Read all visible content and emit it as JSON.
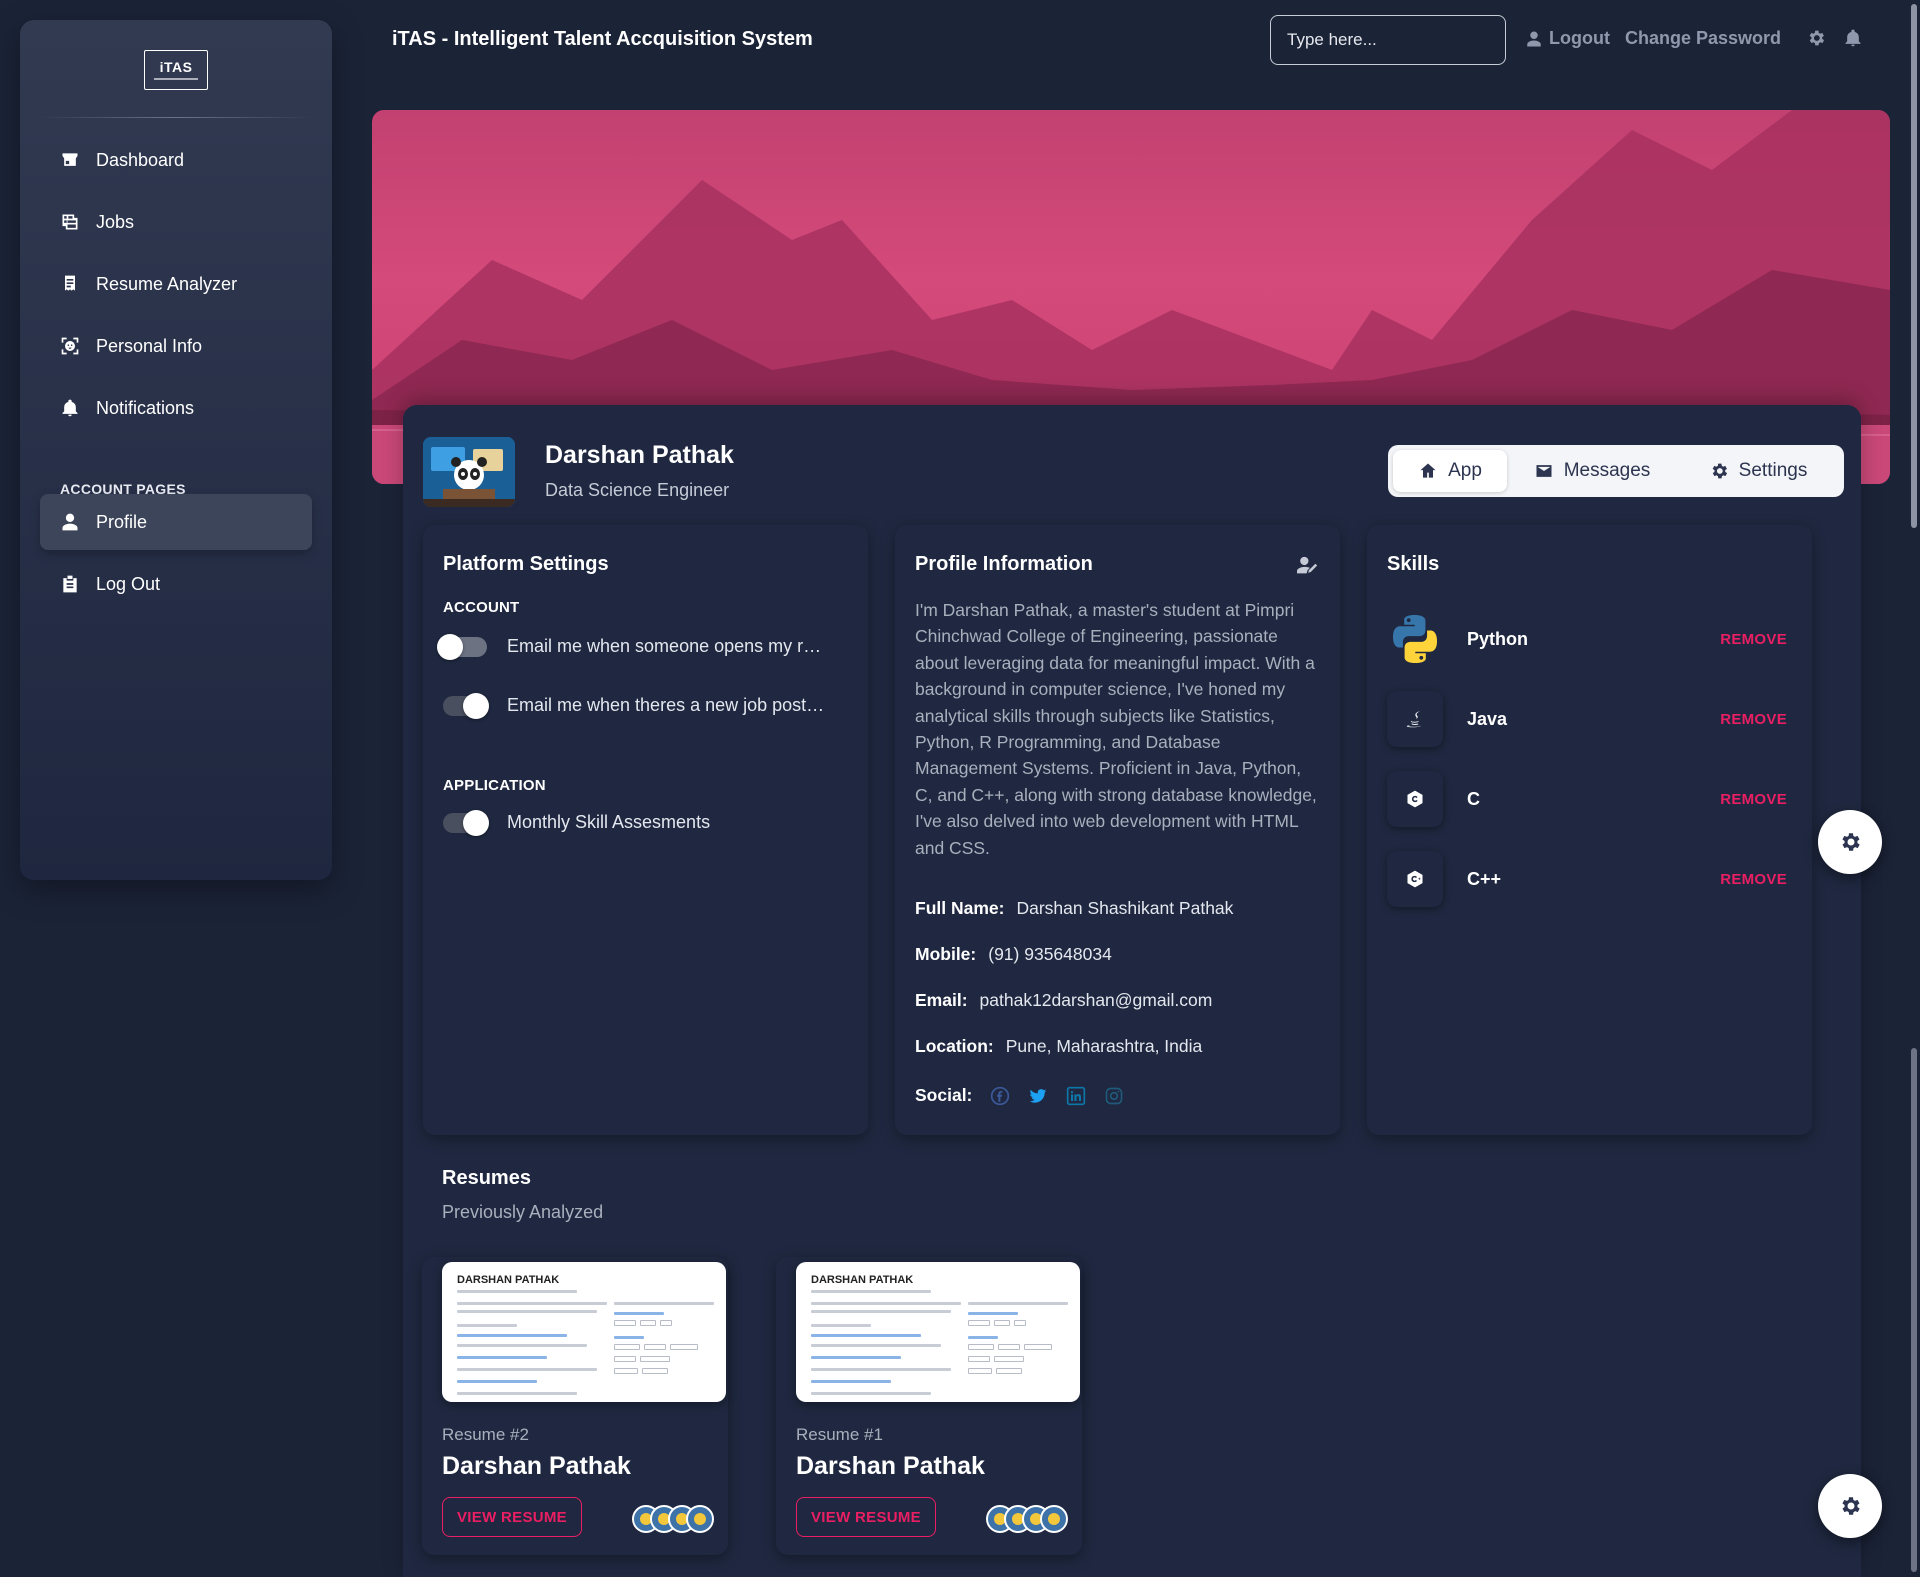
{
  "app": {
    "title": "iTAS - Intelligent Talent Accquisition System"
  },
  "logo": {
    "text": "iTAS"
  },
  "sidebar": {
    "items": [
      {
        "label": "Dashboard",
        "icon": "store-icon"
      },
      {
        "label": "Jobs",
        "icon": "table-icon"
      },
      {
        "label": "Resume Analyzer",
        "icon": "receipt-icon"
      },
      {
        "label": "Personal Info",
        "icon": "scan-face-icon"
      },
      {
        "label": "Notifications",
        "icon": "bell-icon"
      }
    ],
    "section_label": "ACCOUNT PAGES",
    "account_items": [
      {
        "label": "Profile",
        "icon": "person-icon",
        "active": true
      },
      {
        "label": "Log Out",
        "icon": "badge-icon"
      }
    ]
  },
  "topbar": {
    "search_placeholder": "Type here...",
    "logout_label": "Logout",
    "change_password_label": "Change Password"
  },
  "profile": {
    "name": "Darshan Pathak",
    "role": "Data Science Engineer",
    "tabs": [
      {
        "label": "App",
        "icon": "home-icon",
        "active": true
      },
      {
        "label": "Messages",
        "icon": "mail-icon"
      },
      {
        "label": "Settings",
        "icon": "gear-icon"
      }
    ]
  },
  "platform_settings": {
    "title": "Platform Settings",
    "account_label": "ACCOUNT",
    "application_label": "APPLICATION",
    "account_settings": [
      {
        "label": "Email me when someone opens my resume",
        "enabled": false
      },
      {
        "label": "Email me when theres a new job posting",
        "enabled": true
      }
    ],
    "application_settings": [
      {
        "label": "Monthly Skill Assesments",
        "enabled": true
      }
    ]
  },
  "profile_info": {
    "title": "Profile Information",
    "bio": "I'm Darshan Pathak, a master's student at Pimpri Chinchwad College of Engineering, passionate about leveraging data for meaningful impact. With a background in computer science, I've honed my analytical skills through subjects like Statistics, Python, R Programming, and Database Management Systems. Proficient in Java, Python, C, and C++, along with strong database knowledge, I've also delved into web development with HTML and CSS.",
    "full_name_label": "Full Name:",
    "full_name": "Darshan Shashikant Pathak",
    "mobile_label": "Mobile:",
    "mobile": "(91) 935648034",
    "email_label": "Email:",
    "email": "pathak12darshan@gmail.com",
    "location_label": "Location:",
    "location": "Pune, Maharashtra, India",
    "social_label": "Social:",
    "social": [
      "facebook-icon",
      "twitter-icon",
      "linkedin-icon",
      "instagram-icon"
    ]
  },
  "skills": {
    "title": "Skills",
    "remove_label": "REMOVE",
    "items": [
      {
        "name": "Python",
        "icon": "python-icon"
      },
      {
        "name": "Java",
        "icon": "java-icon"
      },
      {
        "name": "C",
        "icon": "c-icon"
      },
      {
        "name": "C++",
        "icon": "cpp-icon"
      }
    ]
  },
  "resumes": {
    "title": "Resumes",
    "subtitle": "Previously Analyzed",
    "view_label": "VIEW RESUME",
    "thumb_title": "DARSHAN PATHAK",
    "items": [
      {
        "number": "Resume #2",
        "name": "Darshan Pathak"
      },
      {
        "number": "Resume #1",
        "name": "Darshan Pathak"
      }
    ]
  },
  "colors": {
    "background": "#1b2337",
    "card": "#1f2840",
    "accent": "#e91e63",
    "banner": "#c94272"
  }
}
